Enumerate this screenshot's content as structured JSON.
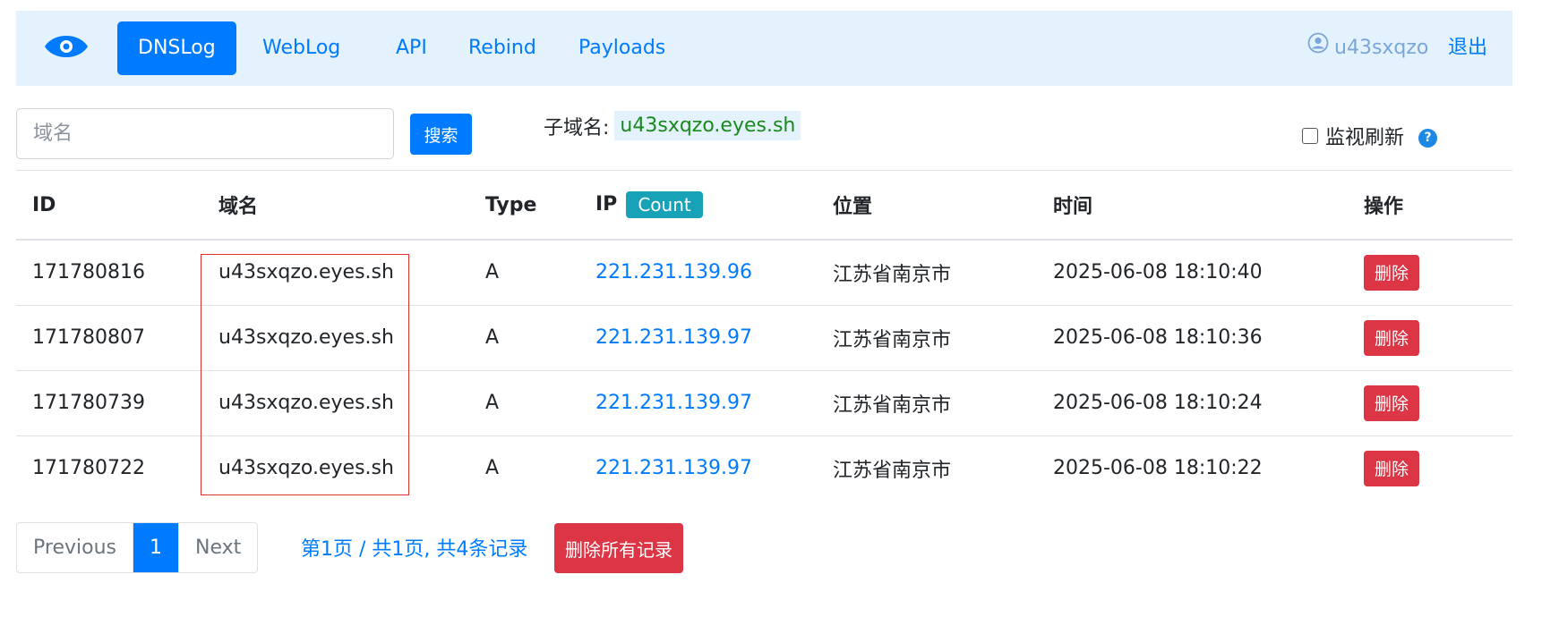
{
  "nav": {
    "tabs": [
      "DNSLog",
      "WebLog",
      "API",
      "Rebind",
      "Payloads"
    ],
    "username": "u43sxqzo",
    "logout_label": "退出"
  },
  "search": {
    "placeholder": "域名",
    "button_label": "搜索"
  },
  "subdomain": {
    "label": "子域名:",
    "value": "u43sxqzo.eyes.sh"
  },
  "monitor": {
    "label": "监视刷新"
  },
  "table": {
    "headers": [
      "ID",
      "域名",
      "Type",
      "IP",
      "位置",
      "时间",
      "操作"
    ],
    "count_badge": "Count",
    "delete_label": "删除",
    "rows": [
      {
        "id": "171780816",
        "domain": "u43sxqzo.eyes.sh",
        "type": "A",
        "ip": "221.231.139.96",
        "location": "江苏省南京市",
        "time": "2025-06-08 18:10:40"
      },
      {
        "id": "171780807",
        "domain": "u43sxqzo.eyes.sh",
        "type": "A",
        "ip": "221.231.139.97",
        "location": "江苏省南京市",
        "time": "2025-06-08 18:10:36"
      },
      {
        "id": "171780739",
        "domain": "u43sxqzo.eyes.sh",
        "type": "A",
        "ip": "221.231.139.97",
        "location": "江苏省南京市",
        "time": "2025-06-08 18:10:24"
      },
      {
        "id": "171780722",
        "domain": "u43sxqzo.eyes.sh",
        "type": "A",
        "ip": "221.231.139.97",
        "location": "江苏省南京市",
        "time": "2025-06-08 18:10:22"
      }
    ]
  },
  "pagination": {
    "previous": "Previous",
    "current": "1",
    "next": "Next",
    "info": "第1页 / 共1页, 共4条记录",
    "delete_all": "删除所有记录"
  },
  "colors": {
    "primary": "#007bff",
    "navbar_bg": "#e3f2fd",
    "danger": "#dc3545",
    "info": "#17a2b8",
    "highlight": "#e03030"
  }
}
